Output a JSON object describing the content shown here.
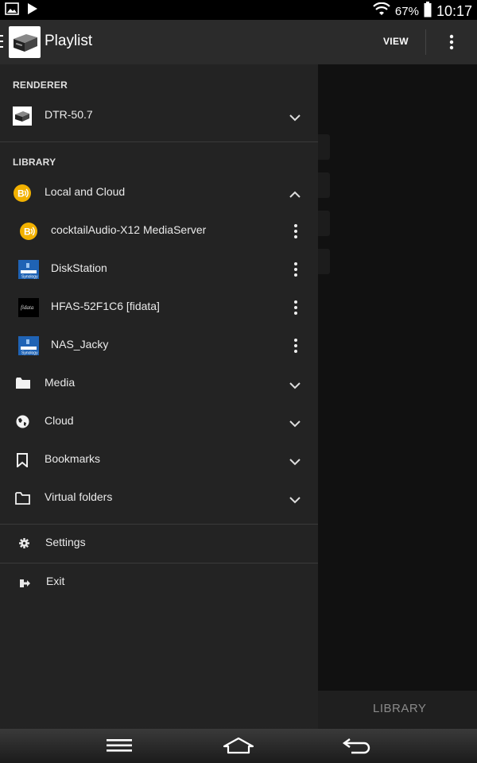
{
  "status_bar": {
    "battery": "67%",
    "time": "10:17"
  },
  "app_bar": {
    "title": "Playlist",
    "view_label": "VIEW"
  },
  "drawer": {
    "renderer_header": "RENDERER",
    "renderer": {
      "label": "DTR-50.7"
    },
    "library_header": "LIBRARY",
    "local_and_cloud": {
      "label": "Local and Cloud"
    },
    "servers": [
      {
        "label": "cocktailAudio-X12 MediaServer",
        "icon": "bubbleupnp-icon"
      },
      {
        "label": "DiskStation",
        "icon": "synology-icon"
      },
      {
        "label": "HFAS-52F1C6 [fidata]",
        "icon": "fidata-icon"
      },
      {
        "label": "NAS_Jacky",
        "icon": "synology-icon"
      }
    ],
    "folders": [
      {
        "label": "Media",
        "icon": "folder-filled-icon"
      },
      {
        "label": "Cloud",
        "icon": "globe-icon"
      },
      {
        "label": "Bookmarks",
        "icon": "bookmark-icon"
      },
      {
        "label": "Virtual folders",
        "icon": "folder-outline-icon"
      }
    ],
    "settings": {
      "label": "Settings"
    },
    "exit": {
      "label": "Exit"
    }
  },
  "background": {
    "library_tab": "LIBRARY"
  },
  "colors": {
    "drawer_bg": "#232323",
    "app_bar_bg": "#2b2b2b",
    "accent_yellow": "#f2b100",
    "synology_blue": "#1f63b5"
  }
}
